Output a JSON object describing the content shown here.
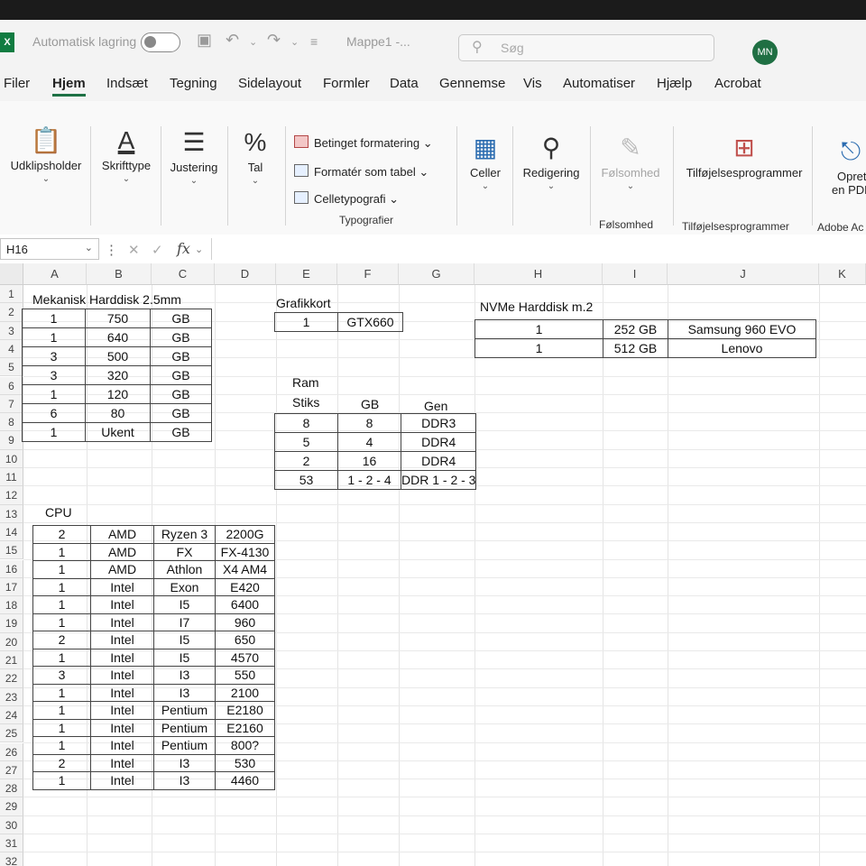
{
  "titlebar": {
    "autosave_label": "Automatisk lagring",
    "doc_title": "Mappe1 -...",
    "search_placeholder": "Søg",
    "user_initials": "MN"
  },
  "menu": [
    "Filer",
    "Hjem",
    "Indsæt",
    "Tegning",
    "Sidelayout",
    "Formler",
    "Data",
    "Gennemse",
    "Vis",
    "Automatiser",
    "Hjælp",
    "Acrobat"
  ],
  "ribbon": {
    "clipboard": "Udklipsholder",
    "font": "Skrifttype",
    "alignment": "Justering",
    "number": "Tal",
    "conditional": "Betinget formatering",
    "format_table": "Formatér som tabel",
    "cell_styles": "Celletypografi",
    "styles_group": "Typografier",
    "cells": "Celler",
    "editing": "Redigering",
    "sensitivity": "Følsomhed",
    "sensitivity_group": "Følsomhed",
    "addins": "Tilføjelsesprogrammer",
    "addins_group": "Tilføjelsesprogrammer",
    "create_pdf_1": "Opret",
    "create_pdf_2": "en PDF",
    "adobe_group": "Adobe Ac"
  },
  "formula_bar": {
    "name_box": "H16",
    "formula": ""
  },
  "columns": [
    "A",
    "B",
    "C",
    "D",
    "E",
    "F",
    "G",
    "H",
    "I",
    "J",
    "K"
  ],
  "rows": [
    "1",
    "2",
    "3",
    "4",
    "5",
    "6",
    "7",
    "8",
    "9",
    "10",
    "11",
    "12",
    "13",
    "14",
    "15",
    "16",
    "17",
    "18",
    "19",
    "20",
    "21",
    "22",
    "23",
    "24",
    "25",
    "26",
    "27",
    "28",
    "29",
    "30",
    "31",
    "32"
  ],
  "hdd": {
    "title": "Mekanisk Harddisk 2.5mm",
    "rows": [
      [
        "1",
        "750",
        "GB"
      ],
      [
        "1",
        "640",
        "GB"
      ],
      [
        "3",
        "500",
        "GB"
      ],
      [
        "3",
        "320",
        "GB"
      ],
      [
        "1",
        "120",
        "GB"
      ],
      [
        "6",
        "80",
        "GB"
      ],
      [
        "1",
        "Ukent",
        "GB"
      ]
    ]
  },
  "gpu": {
    "title": "Grafikkort",
    "rows": [
      [
        "1",
        "GTX660"
      ]
    ]
  },
  "nvme": {
    "title": "NVMe Harddisk m.2",
    "rows": [
      [
        "1",
        "252 GB",
        "Samsung 960 EVO"
      ],
      [
        "1",
        "512 GB",
        "Lenovo"
      ]
    ]
  },
  "ram": {
    "title": "Ram",
    "headers": [
      "Stiks",
      "GB",
      "Gen"
    ],
    "rows": [
      [
        "8",
        "8",
        "DDR3"
      ],
      [
        "5",
        "4",
        "DDR4"
      ],
      [
        "2",
        "16",
        "DDR4"
      ],
      [
        "53",
        "1 - 2 - 4",
        "DDR 1 - 2 - 3"
      ]
    ]
  },
  "cpu": {
    "title": "CPU",
    "rows": [
      [
        "2",
        "AMD",
        "Ryzen 3",
        "2200G"
      ],
      [
        "1",
        "AMD",
        "FX",
        "FX-4130"
      ],
      [
        "1",
        "AMD",
        "Athlon",
        "X4 AM4"
      ],
      [
        "1",
        "Intel",
        "Exon",
        "E420"
      ],
      [
        "1",
        "Intel",
        "I5",
        "6400"
      ],
      [
        "1",
        "Intel",
        "I7",
        "960"
      ],
      [
        "2",
        "Intel",
        "I5",
        "650"
      ],
      [
        "1",
        "Intel",
        "I5",
        "4570"
      ],
      [
        "3",
        "Intel",
        "I3",
        "550"
      ],
      [
        "1",
        "Intel",
        "I3",
        "2100"
      ],
      [
        "1",
        "Intel",
        "Pentium",
        "E2180"
      ],
      [
        "1",
        "Intel",
        "Pentium",
        "E2160"
      ],
      [
        "1",
        "Intel",
        "Pentium",
        "800?"
      ],
      [
        "2",
        "Intel",
        "I3",
        "530"
      ],
      [
        "1",
        "Intel",
        "I3",
        "4460"
      ]
    ]
  }
}
